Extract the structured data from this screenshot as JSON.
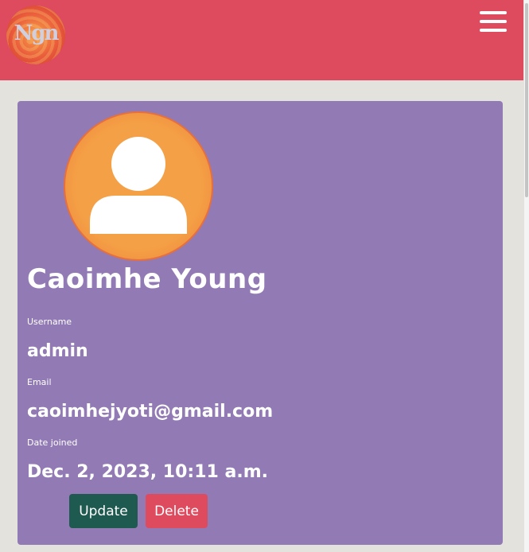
{
  "navbar": {
    "logo_text": "Ngn",
    "menu_icon": "hamburger-menu-icon",
    "background_color": "#de4a5e"
  },
  "profile": {
    "full_name": "Caoimhe Young",
    "avatar_icon": "user-silhouette-icon",
    "username_label": "Username",
    "username": "admin",
    "email_label": "Email",
    "email": "caoimhejyoti@gmail.com",
    "date_joined_label": "Date joined",
    "date_joined": "Dec. 2, 2023, 10:11 a.m.",
    "card_color": "#927ab4"
  },
  "actions": {
    "update_label": "Update",
    "delete_label": "Delete"
  }
}
